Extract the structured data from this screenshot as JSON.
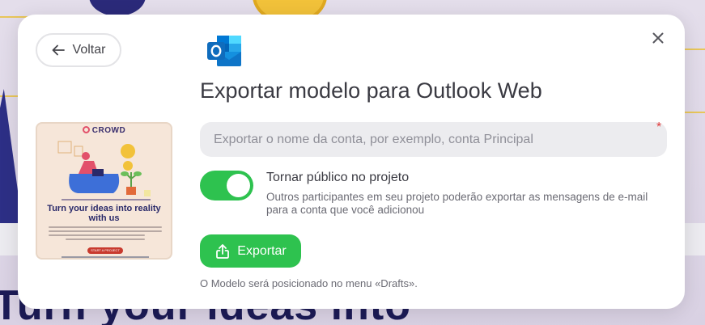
{
  "colors": {
    "accent_green": "#2ec24f",
    "required_red": "#e03b3b",
    "text_dark": "#3a3a42",
    "text_muted": "#6b6b74",
    "outlook_blue": "#0f6cbd"
  },
  "background": {
    "headline": "Turn your ideas into"
  },
  "modal": {
    "back_button": {
      "label": "Voltar",
      "icon": "arrow-left-icon"
    },
    "close_button": {
      "icon": "close-icon"
    },
    "app_icon": "outlook-icon",
    "title": "Exportar modelo para Outlook Web",
    "account_input": {
      "value": "",
      "placeholder": "Exportar o nome da conta, por exemplo, conta Principal",
      "required_mark": "*"
    },
    "public_toggle": {
      "state": "on",
      "title": "Tornar público no projeto",
      "description": "Outros participantes em seu projeto poderão exportar as mensagens de e-mail para a conta que você adicionou"
    },
    "export_button": {
      "label": "Exportar",
      "icon": "share-export-icon"
    },
    "note": "O Modelo será posicionado no menu «Drafts».",
    "preview": {
      "brand": "CROWD",
      "headline": "Turn your ideas into reality with us",
      "cta": "START A PROJECT"
    }
  }
}
